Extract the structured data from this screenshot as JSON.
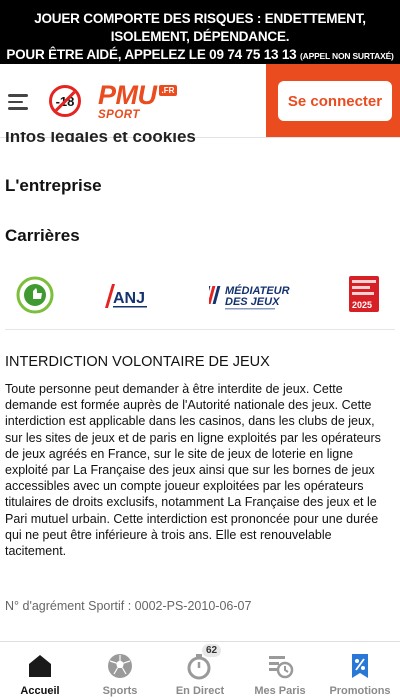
{
  "banner": {
    "line1": "JOUER COMPORTE DES RISQUES : ENDETTEMENT, ISOLEMENT, DÉPENDANCE.",
    "line2": "POUR ÊTRE AIDÉ, APPELEZ LE 09 74 75 13 13 ",
    "line2_small": "(APPEL NON SURTAXÉ)"
  },
  "header": {
    "age_limit": "-18",
    "logo_text": "PMU",
    "logo_domain": ".FR",
    "logo_sub": "SPORT",
    "connect_label": "Se connecter"
  },
  "footer_links": {
    "partial": "Infos légales et cookies",
    "entreprise": "L'entreprise",
    "carrieres": "Carrières"
  },
  "partner_logos": {
    "anj": "ANJ",
    "mediateur_line1": "MÉDIATEUR",
    "mediateur_line2": "DES JEUX",
    "elu_year": "2025"
  },
  "interdiction": {
    "title": "INTERDICTION VOLONTAIRE DE JEUX",
    "text": "Toute personne peut demander à être interdite de jeux. Cette demande est formée auprès de l'Autorité nationale des jeux. Cette interdiction est applicable dans les casinos, dans les clubs de jeux, sur les sites de jeux et de paris en ligne exploités par les opérateurs de jeux agréés en France, sur le site de jeux de loterie en ligne exploité par La Française des jeux ainsi que sur les bornes de jeux accessibles avec un compte joueur exploitées par les opérateurs titulaires de droits exclusifs, notamment La Française des jeux et le Pari mutuel urbain. Cette interdiction est prononcée pour une durée qui ne peut être inférieure à trois ans. Elle est renouvelable tacitement."
  },
  "agrement": "N° d'agrément Sportif : 0002-PS-2010-06-07",
  "nav": {
    "items": [
      {
        "label": "Accueil",
        "icon": "home-icon",
        "active": true
      },
      {
        "label": "Sports",
        "icon": "soccer-ball-icon"
      },
      {
        "label": "En Direct",
        "icon": "stopwatch-icon",
        "badge": "62"
      },
      {
        "label": "Mes Paris",
        "icon": "bet-slip-history-icon"
      },
      {
        "label": "Promotions",
        "icon": "promo-percent-icon"
      }
    ]
  },
  "colors": {
    "brand_orange": "#ea4b1f",
    "banner_bg": "#000000",
    "promo_blue": "#2a78d6"
  }
}
